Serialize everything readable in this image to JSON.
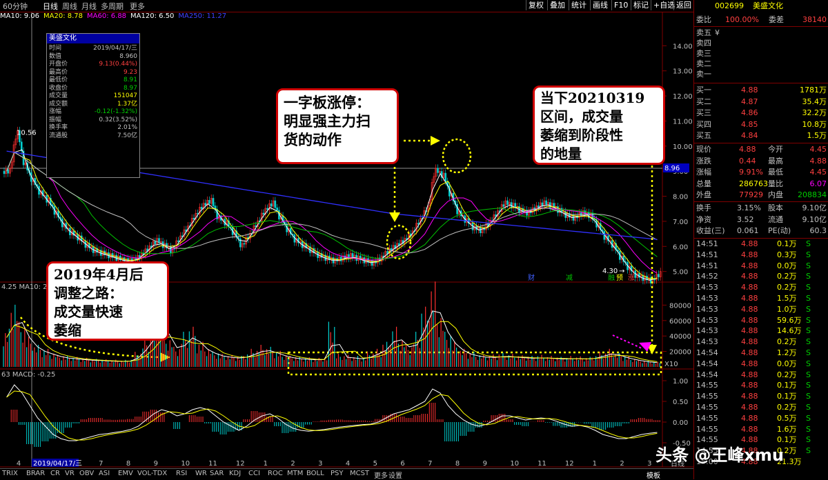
{
  "toolbar": {
    "period_tabs": [
      "60分钟",
      "日线",
      "周线",
      "月线",
      "多周期",
      "更多"
    ],
    "active_period": "日线",
    "buttons": [
      "复权",
      "叠加",
      "统计",
      "画线",
      "F10",
      "标记",
      "+自选",
      "返回"
    ]
  },
  "ma_line": [
    {
      "label": "MA10: 9.06",
      "color": "#ffffff"
    },
    {
      "label": "MA20: 8.78",
      "color": "#ffff00"
    },
    {
      "label": "MA60: 6.88",
      "color": "#ff00ff"
    },
    {
      "label": "MA120: 6.50",
      "color": "#ffffff"
    },
    {
      "label": "MA250: 11.27",
      "color": "#4040ff"
    }
  ],
  "popup": {
    "title": "美盛文化",
    "rows": [
      {
        "k": "时间",
        "v": "2019/04/17/三",
        "c": "#c0c0c0"
      },
      {
        "k": "数值",
        "v": "8.960",
        "c": "#c0c0c0"
      },
      {
        "k": "开盘价",
        "v": "9.13(0.44%)",
        "c": "#ff4040"
      },
      {
        "k": "最高价",
        "v": "9.23",
        "c": "#ff4040"
      },
      {
        "k": "最低价",
        "v": "8.91",
        "c": "#00d000"
      },
      {
        "k": "收盘价",
        "v": "8.97",
        "c": "#00d000"
      },
      {
        "k": "成交量",
        "v": "151047",
        "c": "#ffff00"
      },
      {
        "k": "成交额",
        "v": "1.37亿",
        "c": "#ffff00"
      },
      {
        "k": "涨幅",
        "v": "-0.12(-1.32%)",
        "c": "#00d000"
      },
      {
        "k": "振幅",
        "v": "0.32(3.52%)",
        "c": "#c0c0c0"
      },
      {
        "k": "换手率",
        "v": "2.01%",
        "c": "#c0c0c0"
      },
      {
        "k": "流通股",
        "v": "7.50亿",
        "c": "#c0c0c0"
      }
    ]
  },
  "annotations": {
    "callout1": [
      "一字板涨停：",
      "明显强主力扫",
      "货的动作"
    ],
    "callout2": [
      "当下20210319",
      "区间，成交量",
      "萎缩到阶段性",
      "的地量"
    ],
    "callout3": [
      "2019年4月后",
      "调整之路：",
      "成交量快速",
      "萎缩"
    ],
    "peak_label": "10.56",
    "low_label": "4.30",
    "cursor_price": "8.96",
    "event_tags": [
      {
        "t": "财",
        "c": "#4060ff"
      },
      {
        "t": "减",
        "c": "#00c000"
      },
      {
        "t": "融",
        "c": "#00c000"
      },
      {
        "t": "预",
        "c": "#ffff00"
      },
      {
        "t": "涨",
        "c": "#ff4040"
      }
    ],
    "vol_factor": "X10",
    "vol_header": "4.25  MA10: 2",
    "macd_header": "63   MACD: -0.25",
    "date_cursor": "2019/04/17/三",
    "bottom_right_label": "日线"
  },
  "chart_data": [
    {
      "type": "candlestick",
      "title": "美盛文化 日线",
      "ylim": [
        4.0,
        15.0
      ],
      "ticks": [
        "14.00",
        "13.00",
        "12.00",
        "11.00",
        "10.00",
        "9.00",
        "8.00",
        "7.00",
        "6.00",
        "5.00"
      ],
      "x_labels": [
        "4",
        "5",
        "6",
        "7",
        "8",
        "9",
        "10",
        "11",
        "12",
        "1",
        "2",
        "3",
        "4",
        "5",
        "6",
        "7",
        "8",
        "9",
        "10",
        "11",
        "12",
        "1",
        "2",
        "3"
      ],
      "close": [
        9.0,
        10.5,
        9.2,
        8.6,
        8.1,
        7.8,
        7.3,
        6.8,
        6.5,
        6.3,
        6.0,
        5.8,
        5.7,
        5.6,
        5.5,
        5.4,
        5.4,
        5.6,
        5.9,
        6.2,
        6.0,
        5.8,
        6.3,
        6.7,
        7.2,
        7.6,
        7.8,
        7.1,
        6.9,
        6.5,
        6.0,
        6.4,
        6.9,
        7.4,
        7.7,
        7.1,
        6.6,
        6.2,
        6.0,
        5.8,
        5.6,
        5.5,
        5.4,
        5.5,
        5.6,
        5.5,
        5.4,
        5.3,
        5.5,
        5.8,
        6.0,
        6.2,
        6.5,
        7.0,
        7.5,
        9.0,
        8.8,
        8.0,
        7.3,
        7.0,
        6.7,
        6.6,
        6.9,
        7.3,
        7.7,
        7.6,
        7.4,
        7.3,
        7.5,
        7.7,
        7.6,
        7.4,
        7.2,
        7.1,
        7.3,
        7.2,
        6.8,
        6.3,
        6.0,
        5.5,
        5.1,
        4.8,
        4.7,
        4.6,
        4.88
      ]
    },
    {
      "type": "bar",
      "title": "成交量",
      "ylim": [
        0,
        100000
      ],
      "ticks": [
        "80000",
        "60000",
        "40000",
        "20000"
      ],
      "values": [
        38000,
        70000,
        45000,
        30000,
        22000,
        18000,
        15000,
        12000,
        11000,
        10000,
        9000,
        8500,
        8000,
        7500,
        7200,
        7000,
        8000,
        15000,
        28000,
        42000,
        55000,
        30000,
        20000,
        35000,
        40000,
        25000,
        20000,
        15000,
        13000,
        12000,
        11000,
        14000,
        18000,
        22000,
        20000,
        16000,
        13000,
        11000,
        10000,
        9500,
        9000,
        10000,
        45000,
        13000,
        12000,
        11000,
        10000,
        15000,
        18000,
        25000,
        40000,
        30000,
        22000,
        35000,
        60000,
        85000,
        55000,
        35000,
        25000,
        18000,
        15000,
        13000,
        12000,
        12500,
        14000,
        13000,
        12000,
        11500,
        11000,
        12000,
        11000,
        10500,
        10000,
        11000,
        10500,
        10000,
        12000,
        15000,
        18000,
        14000,
        11000,
        9000,
        7000,
        6000,
        5000
      ]
    },
    {
      "type": "line",
      "title": "MACD",
      "ylim": [
        -1.0,
        1.2
      ],
      "ticks": [
        "1.00",
        "0.50",
        "0.00",
        "-0.50"
      ],
      "values": [
        0.6,
        0.9,
        0.7,
        0.4,
        0.1,
        -0.1,
        -0.3,
        -0.4,
        -0.45,
        -0.45,
        -0.4,
        -0.35,
        -0.3,
        -0.28,
        -0.25,
        -0.22,
        -0.18,
        -0.1,
        0.05,
        0.2,
        0.3,
        0.25,
        0.15,
        0.2,
        0.3,
        0.35,
        0.3,
        0.15,
        0.0,
        -0.1,
        -0.2,
        -0.1,
        0.05,
        0.15,
        0.2,
        0.1,
        -0.05,
        -0.15,
        -0.2,
        -0.22,
        -0.2,
        -0.18,
        -0.15,
        -0.12,
        -0.1,
        -0.08,
        -0.06,
        -0.05,
        0.0,
        0.1,
        0.2,
        0.25,
        0.3,
        0.4,
        0.5,
        0.8,
        0.7,
        0.4,
        0.2,
        0.05,
        -0.05,
        -0.1,
        -0.05,
        0.05,
        0.15,
        0.15,
        0.1,
        0.05,
        0.08,
        0.1,
        0.08,
        0.02,
        -0.05,
        -0.1,
        -0.08,
        -0.12,
        -0.2,
        -0.3,
        -0.35,
        -0.4,
        -0.4,
        -0.35,
        -0.3,
        -0.27,
        -0.25
      ]
    }
  ],
  "quote_panel": {
    "code": "002699",
    "name": "美盛文化",
    "weibi": {
      "k": "委比",
      "v": "100.00%",
      "k2": "委差",
      "v2": "38140"
    },
    "sell": [
      "卖五",
      "卖四",
      "卖三",
      "卖二",
      "卖一"
    ],
    "sell5_suffix": "¥",
    "buy": [
      {
        "k": "买一",
        "p": "4.88",
        "v": "1781万"
      },
      {
        "k": "买二",
        "p": "4.87",
        "v": "35.4万"
      },
      {
        "k": "买三",
        "p": "4.86",
        "v": "32.2万"
      },
      {
        "k": "买四",
        "p": "4.85",
        "v": "10.8万"
      },
      {
        "k": "买五",
        "p": "4.84",
        "v": "1.5万"
      }
    ],
    "stats": [
      {
        "k": "现价",
        "v": "4.88",
        "k2": "今开",
        "v2": "4.45",
        "c": "#ff4040",
        "c2": "#ff4040"
      },
      {
        "k": "涨跌",
        "v": "0.44",
        "k2": "最高",
        "v2": "4.88",
        "c": "#ff4040",
        "c2": "#ff4040"
      },
      {
        "k": "涨幅",
        "v": "9.91%",
        "k2": "最低",
        "v2": "4.45",
        "c": "#ff4040",
        "c2": "#ff4040"
      },
      {
        "k": "总量",
        "v": "286763",
        "k2": "量比",
        "v2": "6.07",
        "c": "#ffff00",
        "c2": "#ff00ff"
      },
      {
        "k": "外盘",
        "v": "77929",
        "k2": "内盘",
        "v2": "208834",
        "c": "#ff4040",
        "c2": "#00d000"
      }
    ],
    "fin": [
      {
        "k": "换手",
        "v": "3.15%",
        "k2": "股本",
        "v2": "9.10亿"
      },
      {
        "k": "净资",
        "v": "3.52",
        "k2": "流通",
        "v2": "9.10亿"
      },
      {
        "k": "收益(三)",
        "v": "0.061",
        "k2": "PE(动)",
        "v2": "60.3"
      }
    ],
    "ticks": [
      {
        "t": "14:51",
        "p": "4.88",
        "v": "0.1万",
        "s": "S"
      },
      {
        "t": "14:51",
        "p": "4.88",
        "v": "0.3万",
        "s": "S"
      },
      {
        "t": "14:51",
        "p": "4.88",
        "v": "0.0万",
        "s": "S"
      },
      {
        "t": "14:52",
        "p": "4.88",
        "v": "0.2万",
        "s": "S"
      },
      {
        "t": "14:53",
        "p": "4.88",
        "v": "0.2万",
        "s": "S"
      },
      {
        "t": "14:53",
        "p": "4.88",
        "v": "1.5万",
        "s": "S"
      },
      {
        "t": "14:53",
        "p": "4.88",
        "v": "1.0万",
        "s": "S"
      },
      {
        "t": "14:53",
        "p": "4.88",
        "v": "59.6万",
        "s": "S"
      },
      {
        "t": "14:53",
        "p": "4.88",
        "v": "14.6万",
        "s": "S"
      },
      {
        "t": "14:53",
        "p": "4.88",
        "v": "0.2万",
        "s": "S"
      },
      {
        "t": "14:54",
        "p": "4.88",
        "v": "1.2万",
        "s": "S"
      },
      {
        "t": "14:54",
        "p": "4.88",
        "v": "0.0万",
        "s": "S"
      },
      {
        "t": "14:54",
        "p": "4.88",
        "v": "0.2万",
        "s": "S"
      },
      {
        "t": "14:55",
        "p": "4.88",
        "v": "0.1万",
        "s": "S"
      },
      {
        "t": "14:55",
        "p": "4.88",
        "v": "0.1万",
        "s": "S"
      },
      {
        "t": "14:55",
        "p": "4.88",
        "v": "0.2万",
        "s": "S"
      },
      {
        "t": "14:55",
        "p": "4.88",
        "v": "0.5万",
        "s": "S"
      },
      {
        "t": "14:55",
        "p": "4.88",
        "v": "1.6万",
        "s": "S"
      },
      {
        "t": "14:55",
        "p": "4.88",
        "v": "0.1万",
        "s": "S"
      },
      {
        "t": "14:55",
        "p": "4.88",
        "v": "0.2万",
        "s": "S"
      },
      {
        "t": "15:00",
        "p": "4.88",
        "v": "21.3万",
        "s": ""
      }
    ]
  },
  "bottom_tabs": [
    "TRIX",
    "BRAR",
    "CR",
    "VR",
    "OBV",
    "ASI",
    "EMV",
    "VOL-TDX",
    "RSI",
    "WR",
    "SAR",
    "KDJ",
    "CCI",
    "ROC",
    "MTM",
    "BOLL",
    "PSY",
    "MCST",
    "更多",
    "设置"
  ],
  "template_label": "模板",
  "watermark": "头条 @王峰xmu"
}
